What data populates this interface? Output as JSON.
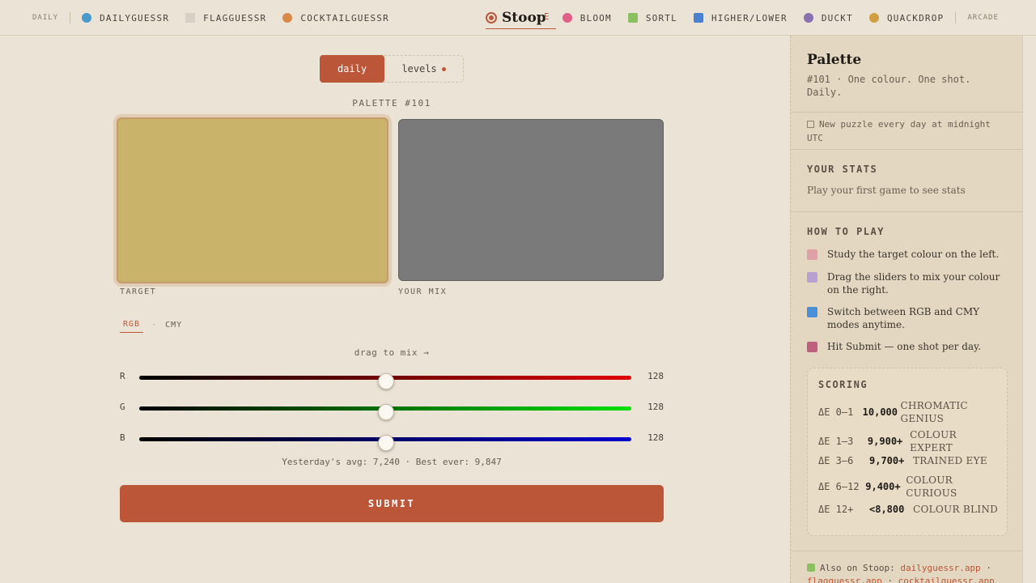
{
  "nav": {
    "daily": "DAILY",
    "left_links": [
      {
        "label": "DAILYGUESSR",
        "color": "#4a9acb"
      },
      {
        "label": "FLAGGUESSR",
        "color": "#d8d0c4"
      },
      {
        "label": "COCKTAILGUESSR",
        "color": "#d98a4a"
      }
    ],
    "brand": "Stoop",
    "brand_ghost": "E",
    "right_links": [
      {
        "label": "BLOOM",
        "color": "#e0608a"
      },
      {
        "label": "SORTL",
        "color": "#8ac060"
      },
      {
        "label": "HIGHER/LOWER",
        "color": "#4a80d0"
      },
      {
        "label": "DUCKT",
        "color": "#8a70b0"
      },
      {
        "label": "QUACKDROP",
        "color": "#d0a040"
      }
    ],
    "arcade": "ARCADE"
  },
  "mode_toggle": {
    "daily": "daily",
    "levels": "levels"
  },
  "puzzle_label": "PALETTE #101",
  "swatches": {
    "target_label": "TARGET",
    "mix_label": "YOUR MIX",
    "target_color": "#c9b36a",
    "mix_color": "#7a7a7a"
  },
  "color_modes": {
    "rgb": "RGB",
    "dot": "·",
    "cmy": "CMY"
  },
  "drag_hint": "drag to mix →",
  "sliders": [
    {
      "letter": "R",
      "value": "128",
      "gradient_end": "#e00000"
    },
    {
      "letter": "G",
      "value": "128",
      "gradient_end": "#00e000"
    },
    {
      "letter": "B",
      "value": "128",
      "gradient_end": "#0000d0"
    }
  ],
  "yesterday": "Yesterday's avg: 7,240 · Best ever: 9,847",
  "submit": "SUBMIT",
  "sidebar": {
    "title": "Palette",
    "subtitle": "#101 · One colour. One shot. Daily.",
    "notice": "New puzzle every day at midnight UTC",
    "stats_heading": "YOUR STATS",
    "stats_text": "Play your first game to see stats",
    "htp_heading": "HOW TO PLAY",
    "htp": [
      {
        "text": "Study the target colour on the left.",
        "color": "#e0a0a8"
      },
      {
        "text": "Drag the sliders to mix your colour on the right.",
        "color": "#b8a0d0"
      },
      {
        "text": "Switch between RGB and CMY modes anytime.",
        "color": "#4a90d8"
      },
      {
        "text": "Hit Submit — one shot per day.",
        "color": "#c06080"
      }
    ],
    "scoring_heading": "SCORING",
    "scoring": [
      {
        "de": "ΔE 0–1",
        "pts": "10,000",
        "label": "CHROMATIC GENIUS"
      },
      {
        "de": "ΔE 1–3",
        "pts": "9,900+",
        "label": "COLOUR EXPERT"
      },
      {
        "de": "ΔE 3–6",
        "pts": "9,700+",
        "label": "TRAINED EYE"
      },
      {
        "de": "ΔE 6–12",
        "pts": "9,400+",
        "label": "COLOUR CURIOUS"
      },
      {
        "de": "ΔE 12+",
        "pts": "<8,800",
        "label": "COLOUR BLIND"
      }
    ],
    "also_prefix": "Also on Stoop:",
    "also_links": [
      "dailyguessr.app",
      "flagguessr.app",
      "cocktailguessr.app"
    ]
  }
}
